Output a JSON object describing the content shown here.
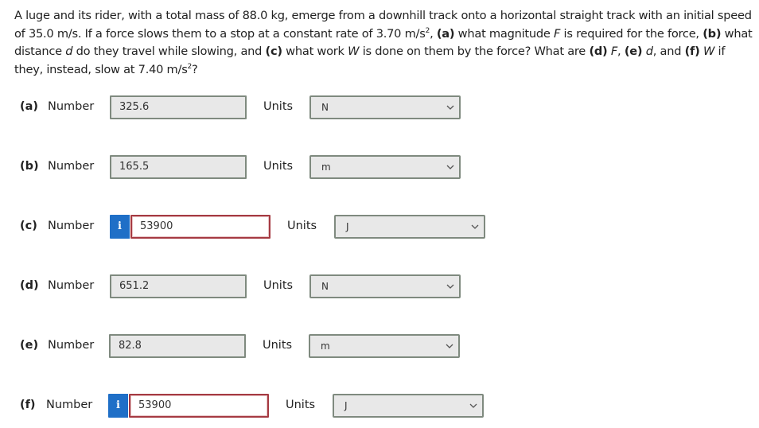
{
  "problem": {
    "s1": "A luge and its rider, with a total mass of 88.0 kg, emerge from a downhill track onto a horizontal straight track with an initial speed of 35.0 m/s. If a force slows them to a stop at a constant rate of 3.70 m/s",
    "sup1": "2",
    "s2": ", ",
    "a_tag": "(a)",
    "s3": " what magnitude ",
    "F1": "F",
    "s4": " is required for the force, ",
    "b_tag": "(b)",
    "s5": " what distance ",
    "d1": "d",
    "s6": " do they travel while slowing, and ",
    "c_tag": "(c)",
    "s7": " what work ",
    "W1": "W",
    "s8": " is done on them by the force? What are ",
    "d_tag": "(d)",
    "s9": " ",
    "F2": "F",
    "s10": ", ",
    "e_tag": "(e)",
    "s11": " ",
    "d2": "d",
    "s12": ", and ",
    "f_tag": "(f)",
    "s13": " ",
    "W2": "W",
    "s14": " if they, instead, slow at 7.40 m/s",
    "sup2": "2",
    "s15": "?"
  },
  "answers": [
    {
      "part": "(a)",
      "label": "Number",
      "value": "325.6",
      "info": false,
      "units_label": "Units",
      "unit": "N"
    },
    {
      "part": "(b)",
      "label": "Number",
      "value": "165.5",
      "info": false,
      "units_label": "Units",
      "unit": "m"
    },
    {
      "part": "(c)",
      "label": "Number",
      "value": "53900",
      "info": true,
      "info_icon": "i",
      "units_label": "Units",
      "unit": "J"
    },
    {
      "part": "(d)",
      "label": "Number",
      "value": "651.2",
      "info": false,
      "units_label": "Units",
      "unit": "N"
    },
    {
      "part": "(e)",
      "label": "Number",
      "value": "82.8",
      "info": false,
      "units_label": "Units",
      "unit": "m"
    },
    {
      "part": "(f)",
      "label": "Number",
      "value": "53900",
      "info": true,
      "info_icon": "i",
      "units_label": "Units",
      "unit": "J"
    }
  ],
  "colors": {
    "info_blue": "#1f6fc7",
    "error_border": "#a53a42",
    "field_bg": "#e8e8e8",
    "field_border": "#7f8a7f"
  }
}
